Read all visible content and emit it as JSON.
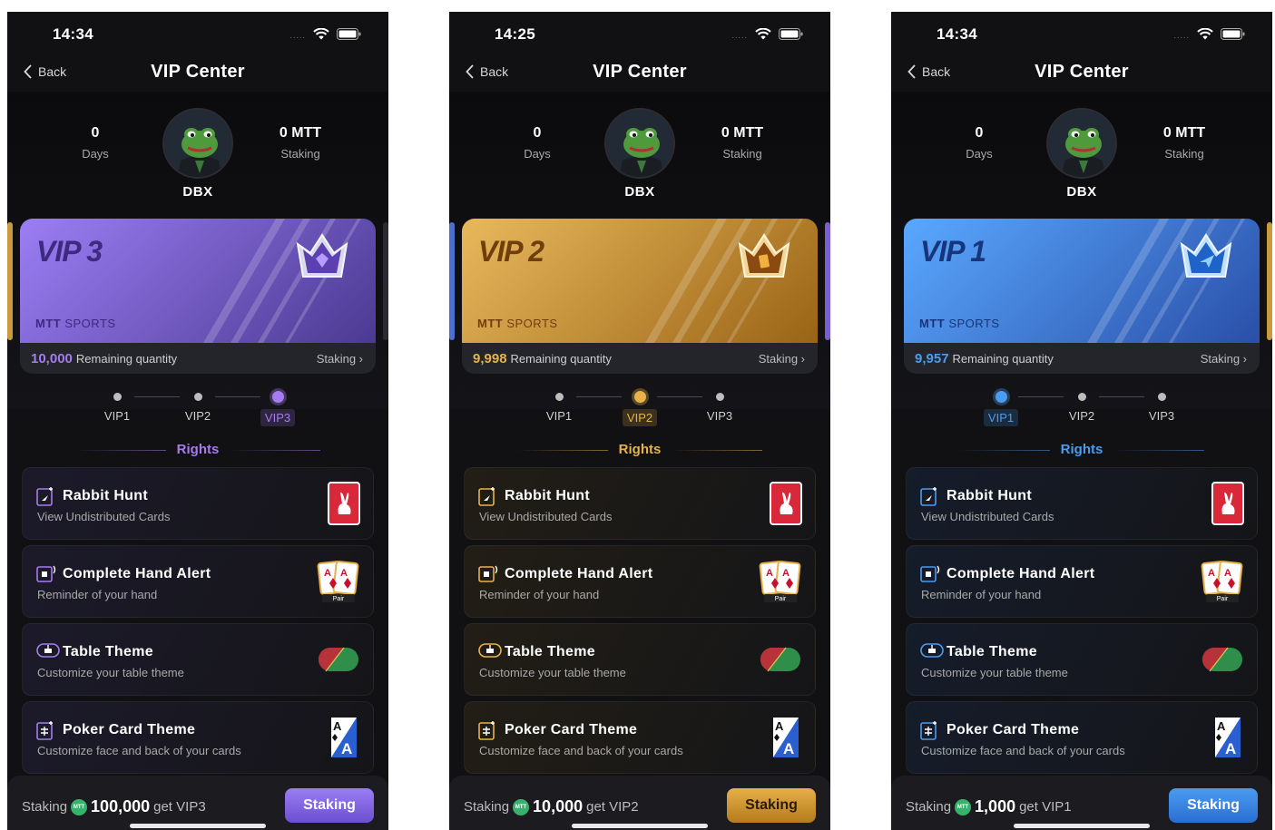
{
  "screens": [
    {
      "status": {
        "time": "14:34",
        "signal": "....."
      },
      "nav": {
        "back": "Back",
        "title": "VIP Center"
      },
      "profile": {
        "days_value": "0",
        "days_label": "Days",
        "staking_value": "0 MTT",
        "staking_label": "Staking",
        "username": "DBX"
      },
      "card": {
        "title": "VIP 3",
        "brand_bold": "MTT",
        "brand_light": "SPORTS",
        "remaining_num": "10,000",
        "remaining_label": "Remaining quantity",
        "staking_link": "Staking ›"
      },
      "levels": [
        "VIP1",
        "VIP2",
        "VIP3"
      ],
      "active_level": 2,
      "rights_title": "Rights",
      "rights": [
        {
          "title": "Rabbit Hunt",
          "desc": "View Undistributed Cards"
        },
        {
          "title": "Complete Hand Alert",
          "desc": "Reminder of your hand",
          "badge": "Pair"
        },
        {
          "title": "Table Theme",
          "desc": "Customize your table theme"
        },
        {
          "title": "Poker Card Theme",
          "desc": "Customize face and back of your cards"
        }
      ],
      "bottom": {
        "prefix": "Staking",
        "coin": "MTT",
        "amount": "100,000",
        "suffix": "get VIP3",
        "button": "Staking"
      },
      "colors": {
        "accent": "#a57cf0",
        "card_from": "#9b7ef4",
        "card_to": "#4b3a92",
        "title_color": "#3d2a80",
        "rights_bg": "#1c1a2a",
        "button_from": "#9b7ef4",
        "button_to": "#6a4fd0",
        "button_text": "#ffffff"
      }
    },
    {
      "status": {
        "time": "14:25",
        "signal": "....."
      },
      "nav": {
        "back": "Back",
        "title": "VIP Center"
      },
      "profile": {
        "days_value": "0",
        "days_label": "Days",
        "staking_value": "0 MTT",
        "staking_label": "Staking",
        "username": "DBX"
      },
      "card": {
        "title": "VIP 2",
        "brand_bold": "MTT",
        "brand_light": "SPORTS",
        "remaining_num": "9,998",
        "remaining_label": "Remaining quantity",
        "staking_link": "Staking ›"
      },
      "levels": [
        "VIP1",
        "VIP2",
        "VIP3"
      ],
      "active_level": 1,
      "rights_title": "Rights",
      "rights": [
        {
          "title": "Rabbit Hunt",
          "desc": "View Undistributed Cards"
        },
        {
          "title": "Complete Hand Alert",
          "desc": "Reminder of your hand",
          "badge": "Pair"
        },
        {
          "title": "Table Theme",
          "desc": "Customize your table theme"
        },
        {
          "title": "Poker Card Theme",
          "desc": "Customize face and back of your cards"
        }
      ],
      "bottom": {
        "prefix": "Staking",
        "coin": "MTT",
        "amount": "10,000",
        "suffix": "get VIP2",
        "button": "Staking"
      },
      "colors": {
        "accent": "#e8b24a",
        "card_from": "#e9b85c",
        "card_to": "#9a6416",
        "title_color": "#6e3e0c",
        "rights_bg": "#221e16",
        "button_from": "#e6b04a",
        "button_to": "#b57a1c",
        "button_text": "#2a1b05"
      }
    },
    {
      "status": {
        "time": "14:34",
        "signal": "....."
      },
      "nav": {
        "back": "Back",
        "title": "VIP Center"
      },
      "profile": {
        "days_value": "0",
        "days_label": "Days",
        "staking_value": "0 MTT",
        "staking_label": "Staking",
        "username": "DBX"
      },
      "card": {
        "title": "VIP 1",
        "brand_bold": "MTT",
        "brand_light": "SPORTS",
        "remaining_num": "9,957",
        "remaining_label": "Remaining quantity",
        "staking_link": "Staking ›"
      },
      "levels": [
        "VIP1",
        "VIP2",
        "VIP3"
      ],
      "active_level": 0,
      "rights_title": "Rights",
      "rights": [
        {
          "title": "Rabbit Hunt",
          "desc": "View Undistributed Cards"
        },
        {
          "title": "Complete Hand Alert",
          "desc": "Reminder of your hand",
          "badge": "Pair"
        },
        {
          "title": "Table Theme",
          "desc": "Customize your table theme"
        },
        {
          "title": "Poker Card Theme",
          "desc": "Customize face and back of your cards"
        }
      ],
      "bottom": {
        "prefix": "Staking",
        "coin": "MTT",
        "amount": "1,000",
        "suffix": "get VIP1",
        "button": "Staking"
      },
      "colors": {
        "accent": "#4a9cf0",
        "card_from": "#5aa8ff",
        "card_to": "#2a4fa8",
        "title_color": "#17357a",
        "rights_bg": "#151c2a",
        "button_from": "#4a9cf0",
        "button_to": "#2a6ed0",
        "button_text": "#ffffff"
      }
    }
  ]
}
